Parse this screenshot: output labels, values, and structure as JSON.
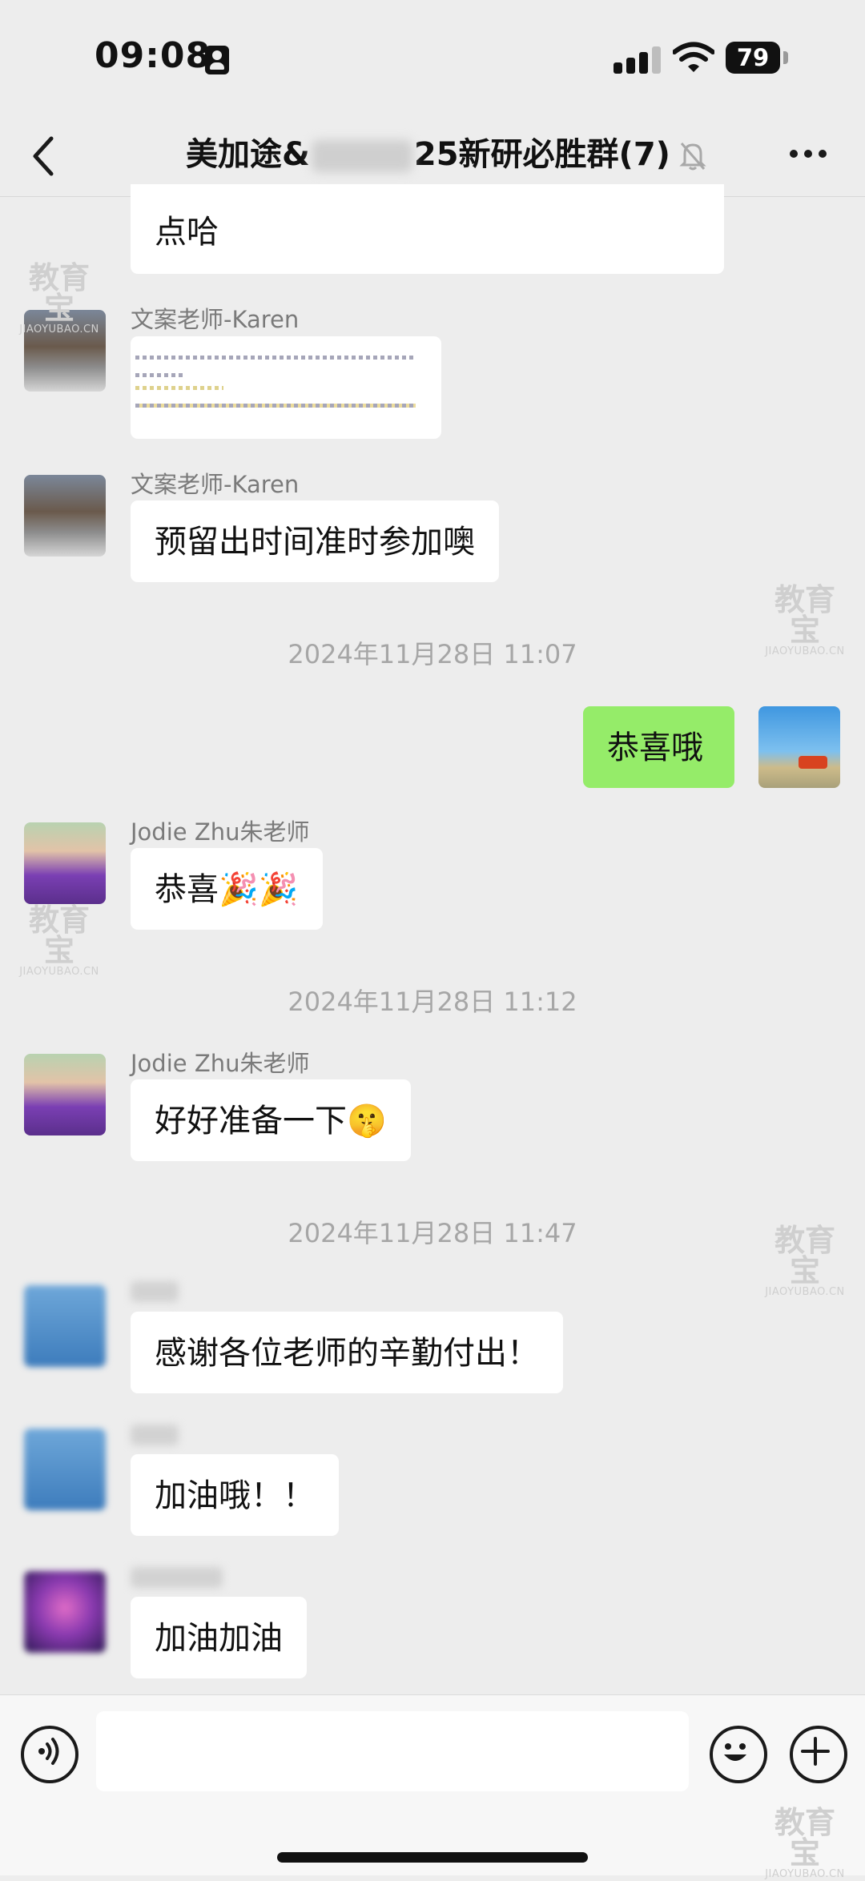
{
  "status_bar": {
    "time": "09:08",
    "battery": "79"
  },
  "nav": {
    "title_prefix": "美加途&",
    "title_suffix": "25新研必胜群(7)"
  },
  "messages": {
    "m0": {
      "text": "点哈"
    },
    "m1": {
      "sender": "文案老师-Karen"
    },
    "m2": {
      "sender": "文案老师-Karen",
      "text": "预留出时间准时参加噢"
    },
    "t1": "2024年11月28日 11:07",
    "m3": {
      "text": "恭喜哦"
    },
    "m4": {
      "sender": "Jodie Zhu朱老师",
      "text": "恭喜🎉🎉"
    },
    "t2": "2024年11月28日 11:12",
    "m5": {
      "sender": "Jodie Zhu朱老师",
      "text": "好好准备一下🤫"
    },
    "t3": "2024年11月28日 11:47",
    "m6": {
      "text": "感谢各位老师的辛勤付出！"
    },
    "m7": {
      "text": "加油哦！！"
    },
    "m8": {
      "text": "加油加油"
    }
  },
  "watermark": {
    "text": "教育宝",
    "domain": "JIAOYUBAO.CN"
  },
  "colors": {
    "background": "#ededed",
    "self_bubble": "#95ec69",
    "other_bubble": "#ffffff"
  },
  "icons": [
    "back-icon",
    "mute-bell-icon",
    "more-icon",
    "voice-icon",
    "emoji-icon",
    "plus-icon"
  ]
}
